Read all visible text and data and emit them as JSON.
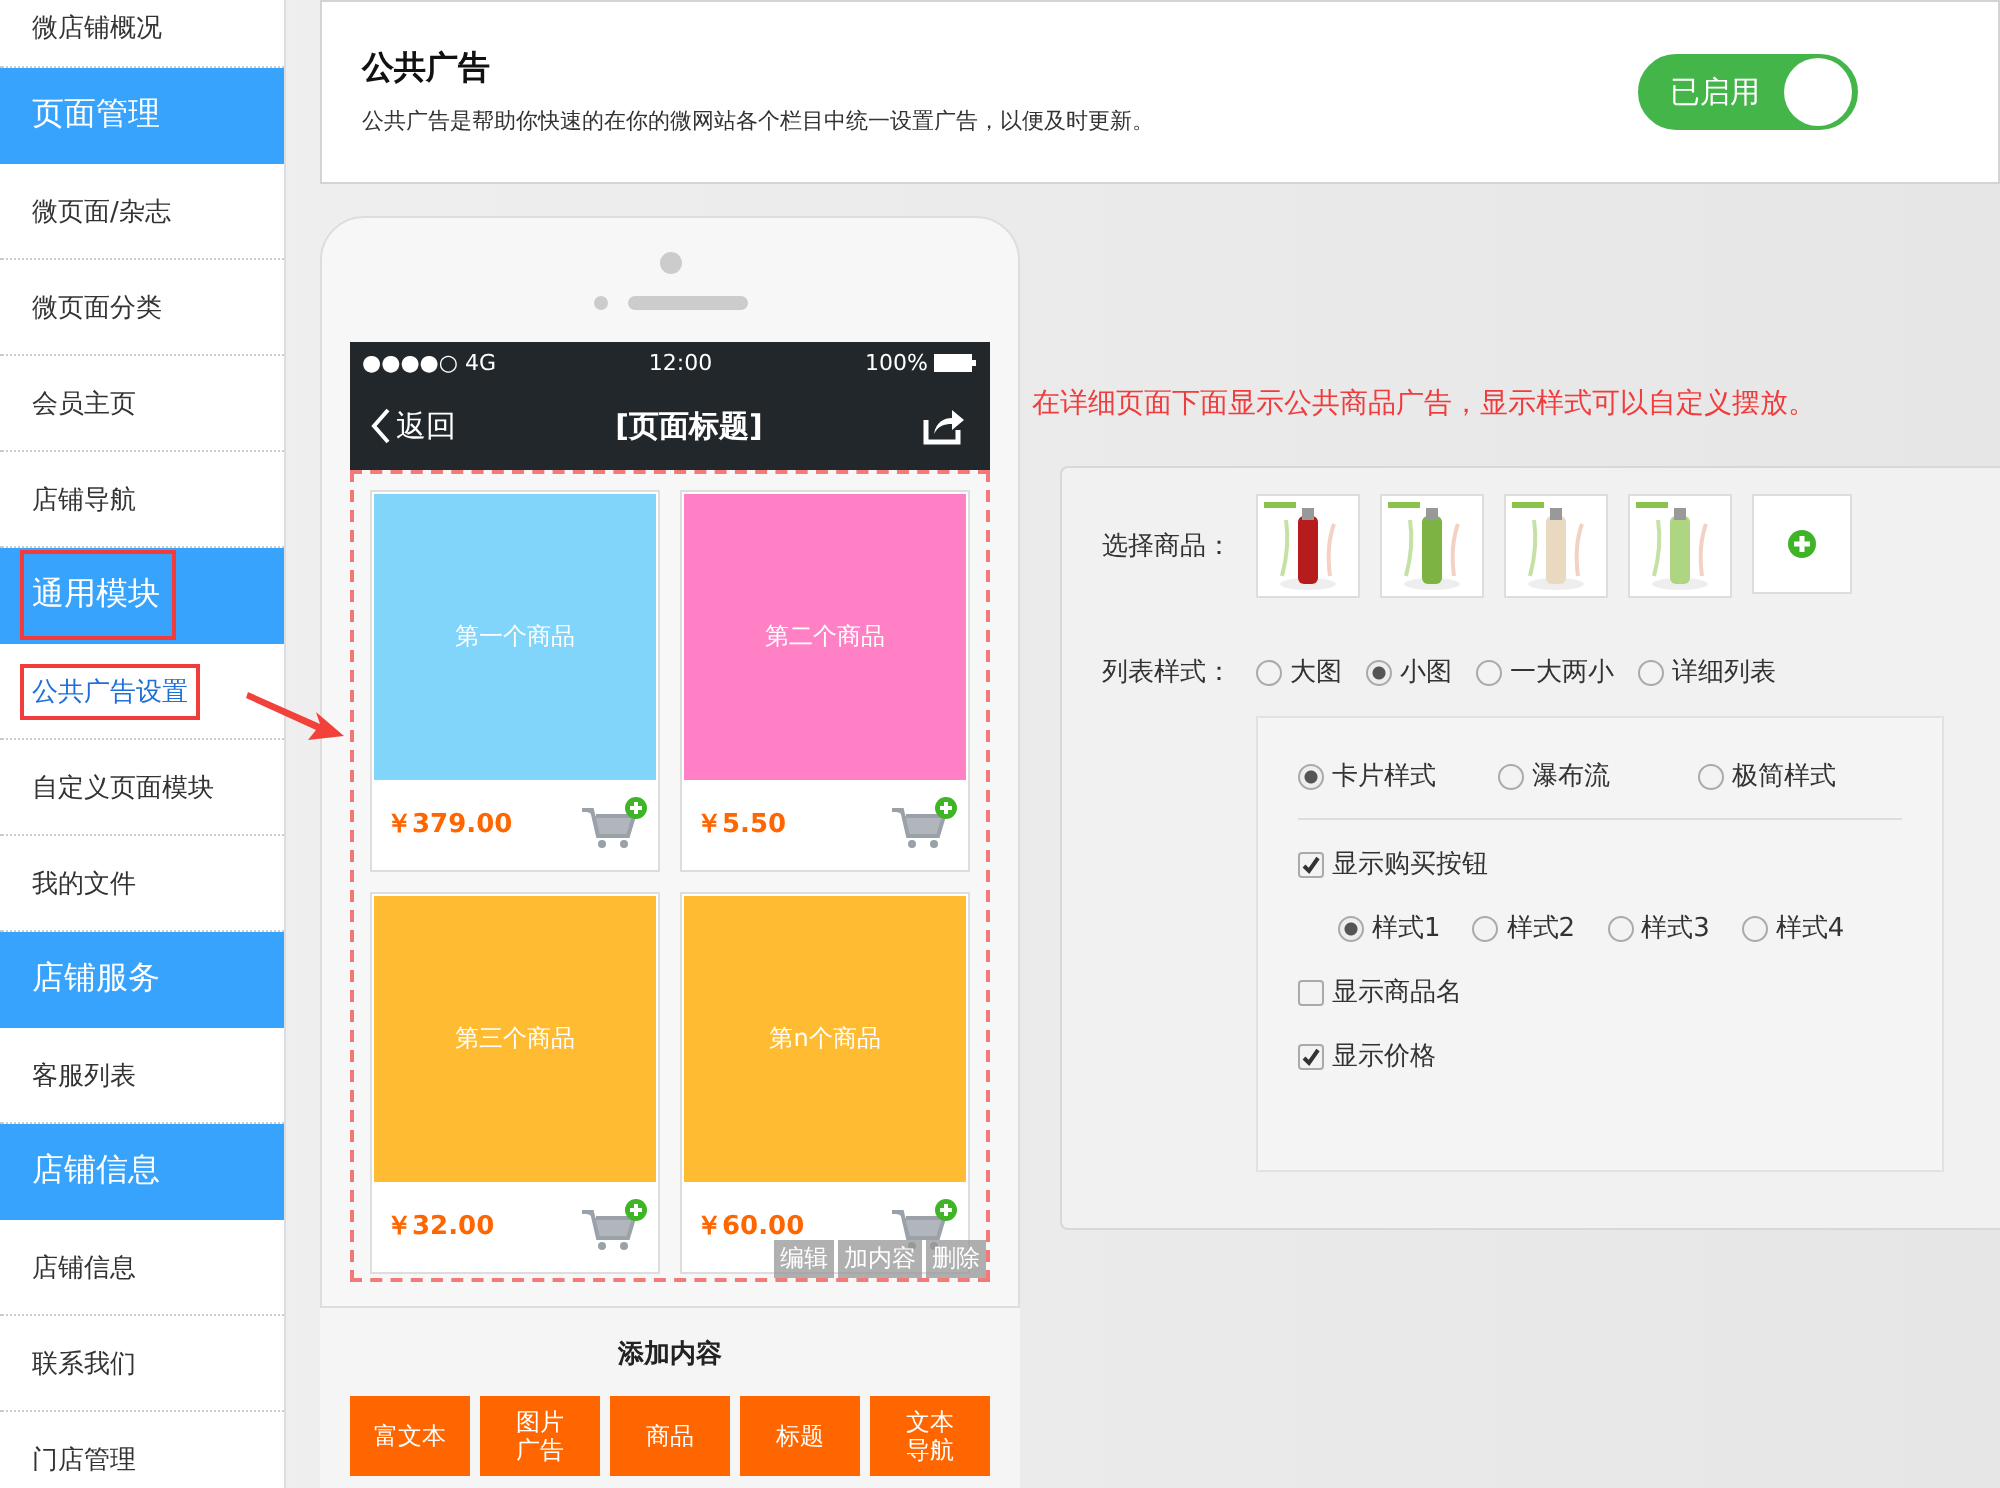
{
  "sidebar": {
    "items": [
      {
        "kind": "item",
        "label": "微店铺概况",
        "selected": false,
        "highlighted": false
      },
      {
        "kind": "header",
        "label": "页面管理",
        "selected": false,
        "highlighted": false
      },
      {
        "kind": "item",
        "label": "微页面/杂志",
        "selected": false,
        "highlighted": false
      },
      {
        "kind": "item",
        "label": "微页面分类",
        "selected": false,
        "highlighted": false
      },
      {
        "kind": "item",
        "label": "会员主页",
        "selected": false,
        "highlighted": false
      },
      {
        "kind": "item",
        "label": "店铺导航",
        "selected": false,
        "highlighted": false
      },
      {
        "kind": "header",
        "label": "通用模块",
        "selected": false,
        "highlighted": true
      },
      {
        "kind": "item",
        "label": "公共广告设置",
        "selected": true,
        "highlighted": true
      },
      {
        "kind": "item",
        "label": "自定义页面模块",
        "selected": false,
        "highlighted": false
      },
      {
        "kind": "item",
        "label": "我的文件",
        "selected": false,
        "highlighted": false
      },
      {
        "kind": "header",
        "label": "店铺服务",
        "selected": false,
        "highlighted": false
      },
      {
        "kind": "item",
        "label": "客服列表",
        "selected": false,
        "highlighted": false
      },
      {
        "kind": "header",
        "label": "店铺信息",
        "selected": false,
        "highlighted": false
      },
      {
        "kind": "item",
        "label": "店铺信息",
        "selected": false,
        "highlighted": false
      },
      {
        "kind": "item",
        "label": "联系我们",
        "selected": false,
        "highlighted": false
      },
      {
        "kind": "item",
        "label": "门店管理",
        "selected": false,
        "highlighted": false
      }
    ]
  },
  "header": {
    "title": "公共广告",
    "description": "公共广告是帮助你快速的在你的微网站各个栏目中统一设置广告，以便及时更新。",
    "toggle": {
      "label": "已启用",
      "on": true
    }
  },
  "phone": {
    "status": {
      "signal": "●●●●○ 4G",
      "time": "12:00",
      "battery": "100%"
    },
    "back": "返回",
    "title": "[页面标题]",
    "products": [
      {
        "name": "第一个商品",
        "price": "￥379.00",
        "color": "#81d4fa"
      },
      {
        "name": "第二个商品",
        "price": "￥5.50",
        "color": "#ff80c4"
      },
      {
        "name": "第三个商品",
        "price": "￥32.00",
        "color": "#ffbc33"
      },
      {
        "name": "第n个商品",
        "price": "￥60.00",
        "color": "#ffbc33"
      }
    ],
    "actions": [
      "编辑",
      "加内容",
      "删除"
    ],
    "add_title": "添加内容",
    "add_buttons": [
      {
        "lines": [
          "富文本"
        ]
      },
      {
        "lines": [
          "图片",
          "广告"
        ]
      },
      {
        "lines": [
          "商品"
        ]
      },
      {
        "lines": [
          "标题"
        ]
      },
      {
        "lines": [
          "文本",
          "导航"
        ]
      }
    ]
  },
  "note": "在详细页面下面显示公共商品广告，显示样式可以自定义摆放。",
  "settings": {
    "select_label": "选择商品：",
    "thumbnails": [
      {
        "kind": "picture"
      },
      {
        "kind": "picture"
      },
      {
        "kind": "picture"
      },
      {
        "kind": "picture"
      },
      {
        "kind": "add"
      }
    ],
    "list_label": "列表样式：",
    "list_styles": [
      {
        "label": "大图",
        "selected": false
      },
      {
        "label": "小图",
        "selected": true
      },
      {
        "label": "一大两小",
        "selected": false
      },
      {
        "label": "详细列表",
        "selected": false
      }
    ],
    "card_styles": [
      {
        "label": "卡片样式",
        "selected": true
      },
      {
        "label": "瀑布流",
        "selected": false
      },
      {
        "label": "极简样式",
        "selected": false
      }
    ],
    "show_buy": {
      "label": "显示购买按钮",
      "checked": true
    },
    "buy_styles": [
      {
        "label": "样式1",
        "selected": true
      },
      {
        "label": "样式2",
        "selected": false
      },
      {
        "label": "样式3",
        "selected": false
      },
      {
        "label": "样式4",
        "selected": false
      }
    ],
    "show_name": {
      "label": "显示商品名",
      "checked": false
    },
    "show_price": {
      "label": "显示价格",
      "checked": true
    }
  }
}
